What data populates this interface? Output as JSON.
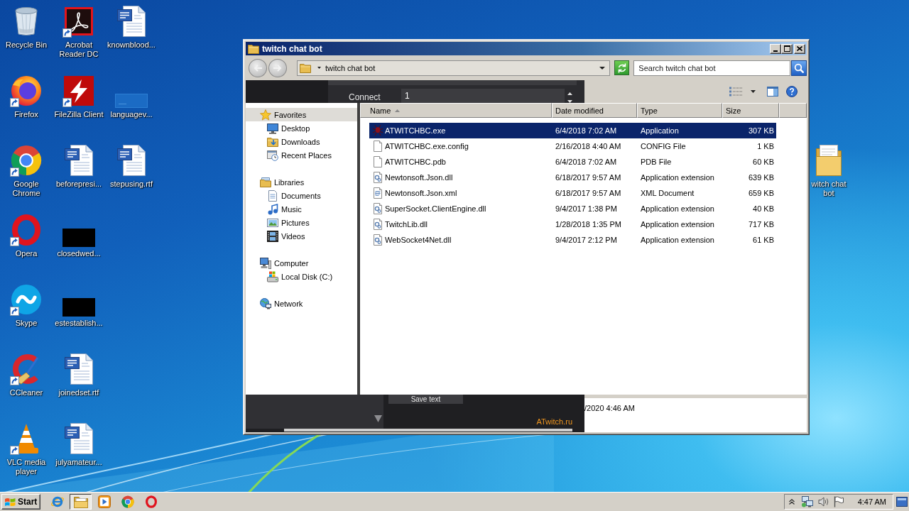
{
  "desktop": {
    "icons": [
      {
        "label": "Recycle Bin",
        "kind": "recycle-bin",
        "shortcut": false
      },
      {
        "label": "Firefox",
        "kind": "firefox",
        "shortcut": true
      },
      {
        "label": "Google Chrome",
        "kind": "chrome",
        "shortcut": true
      },
      {
        "label": "Opera",
        "kind": "opera",
        "shortcut": true
      },
      {
        "label": "Skype",
        "kind": "skype",
        "shortcut": true
      },
      {
        "label": "CCleaner",
        "kind": "ccleaner",
        "shortcut": true
      },
      {
        "label": "VLC media player",
        "kind": "vlc",
        "shortcut": true
      },
      {
        "label": "Acrobat Reader DC",
        "kind": "acrobat",
        "shortcut": true
      },
      {
        "label": "FileZilla Client",
        "kind": "filezilla",
        "shortcut": true
      },
      {
        "label": "beforepresi...",
        "kind": "word-doc",
        "shortcut": false
      },
      {
        "label": "closedwed...",
        "kind": "dark-thumb",
        "shortcut": false
      },
      {
        "label": "estestablish...",
        "kind": "dark-thumb",
        "shortcut": false
      },
      {
        "label": "joinedset.rtf",
        "kind": "word-doc",
        "shortcut": false
      },
      {
        "label": "julyamateur...",
        "kind": "word-doc",
        "shortcut": false
      },
      {
        "label": "knownblood...",
        "kind": "word-doc",
        "shortcut": false
      },
      {
        "label": "languagev...",
        "kind": "blank-thumb",
        "shortcut": false
      },
      {
        "label": "stepusing.rtf",
        "kind": "word-doc",
        "shortcut": false
      }
    ],
    "side_icon": {
      "label": "witch chat bot",
      "kind": "folder",
      "shortcut": false
    }
  },
  "explorer": {
    "title": "twitch chat bot",
    "nav_buttons": [
      {
        "kind": "back",
        "disabled": true
      },
      {
        "kind": "forward",
        "disabled": true
      }
    ],
    "address": "twitch chat bot",
    "search": {
      "placeholder": "Search twitch chat bot"
    },
    "nav_pane": [
      {
        "label": "Favorites",
        "kind": "star",
        "highlighted": true,
        "children": [
          {
            "label": "Desktop",
            "kind": "desktop"
          },
          {
            "label": "Downloads",
            "kind": "downloads"
          },
          {
            "label": "Recent Places",
            "kind": "recent"
          }
        ]
      },
      {
        "label": "Libraries",
        "kind": "libraries",
        "highlighted": false,
        "children": [
          {
            "label": "Documents",
            "kind": "documents"
          },
          {
            "label": "Music",
            "kind": "music"
          },
          {
            "label": "Pictures",
            "kind": "pictures"
          },
          {
            "label": "Videos",
            "kind": "videos"
          }
        ]
      },
      {
        "label": "Computer",
        "kind": "computer",
        "highlighted": false,
        "children": [
          {
            "label": "Local Disk (C:)",
            "kind": "disk"
          }
        ]
      },
      {
        "label": "Network",
        "kind": "network",
        "highlighted": false
      }
    ],
    "columns": [
      {
        "label": "Name",
        "sorted": true
      },
      {
        "label": "Date modified",
        "sorted": false
      },
      {
        "label": "Type",
        "sorted": false
      },
      {
        "label": "Size",
        "sorted": false
      }
    ],
    "files": [
      {
        "name": "ATWITCHBC.exe",
        "date": "6/4/2018 7:02 AM",
        "type": "Application",
        "size": "307 KB",
        "kind": "app",
        "selected": true
      },
      {
        "name": "ATWITCHBC.exe.config",
        "date": "2/16/2018 4:40 AM",
        "type": "CONFIG File",
        "size": "1 KB",
        "kind": "file",
        "selected": false
      },
      {
        "name": "ATWITCHBC.pdb",
        "date": "6/4/2018 7:02 AM",
        "type": "PDB File",
        "size": "60 KB",
        "kind": "file",
        "selected": false
      },
      {
        "name": "Newtonsoft.Json.dll",
        "date": "6/18/2017 9:57 AM",
        "type": "Application extension",
        "size": "639 KB",
        "kind": "dll",
        "selected": false
      },
      {
        "name": "Newtonsoft.Json.xml",
        "date": "6/18/2017 9:57 AM",
        "type": "XML Document",
        "size": "659 KB",
        "kind": "xml",
        "selected": false
      },
      {
        "name": "SuperSocket.ClientEngine.dll",
        "date": "9/4/2017 1:38 PM",
        "type": "Application extension",
        "size": "40 KB",
        "kind": "dll",
        "selected": false
      },
      {
        "name": "TwitchLib.dll",
        "date": "1/28/2018 1:35 PM",
        "type": "Application extension",
        "size": "717 KB",
        "kind": "dll",
        "selected": false
      },
      {
        "name": "WebSocket4Net.dll",
        "date": "9/4/2017 2:12 PM",
        "type": "Application extension",
        "size": "61 KB",
        "kind": "dll",
        "selected": false
      }
    ],
    "details_text": "/2020 4:46 AM"
  },
  "atwitch_app": {
    "field_label": "Connect",
    "field_value": "1",
    "button": "Save text",
    "link": "ATwitch.ru"
  },
  "taskbar": {
    "start": "Start",
    "items": [
      {
        "kind": "ie",
        "selected": false
      },
      {
        "kind": "explorer",
        "selected": true
      },
      {
        "kind": "media",
        "selected": false
      },
      {
        "kind": "chrome",
        "selected": false
      },
      {
        "kind": "opera",
        "selected": false
      }
    ],
    "clock": "4:47 AM"
  }
}
